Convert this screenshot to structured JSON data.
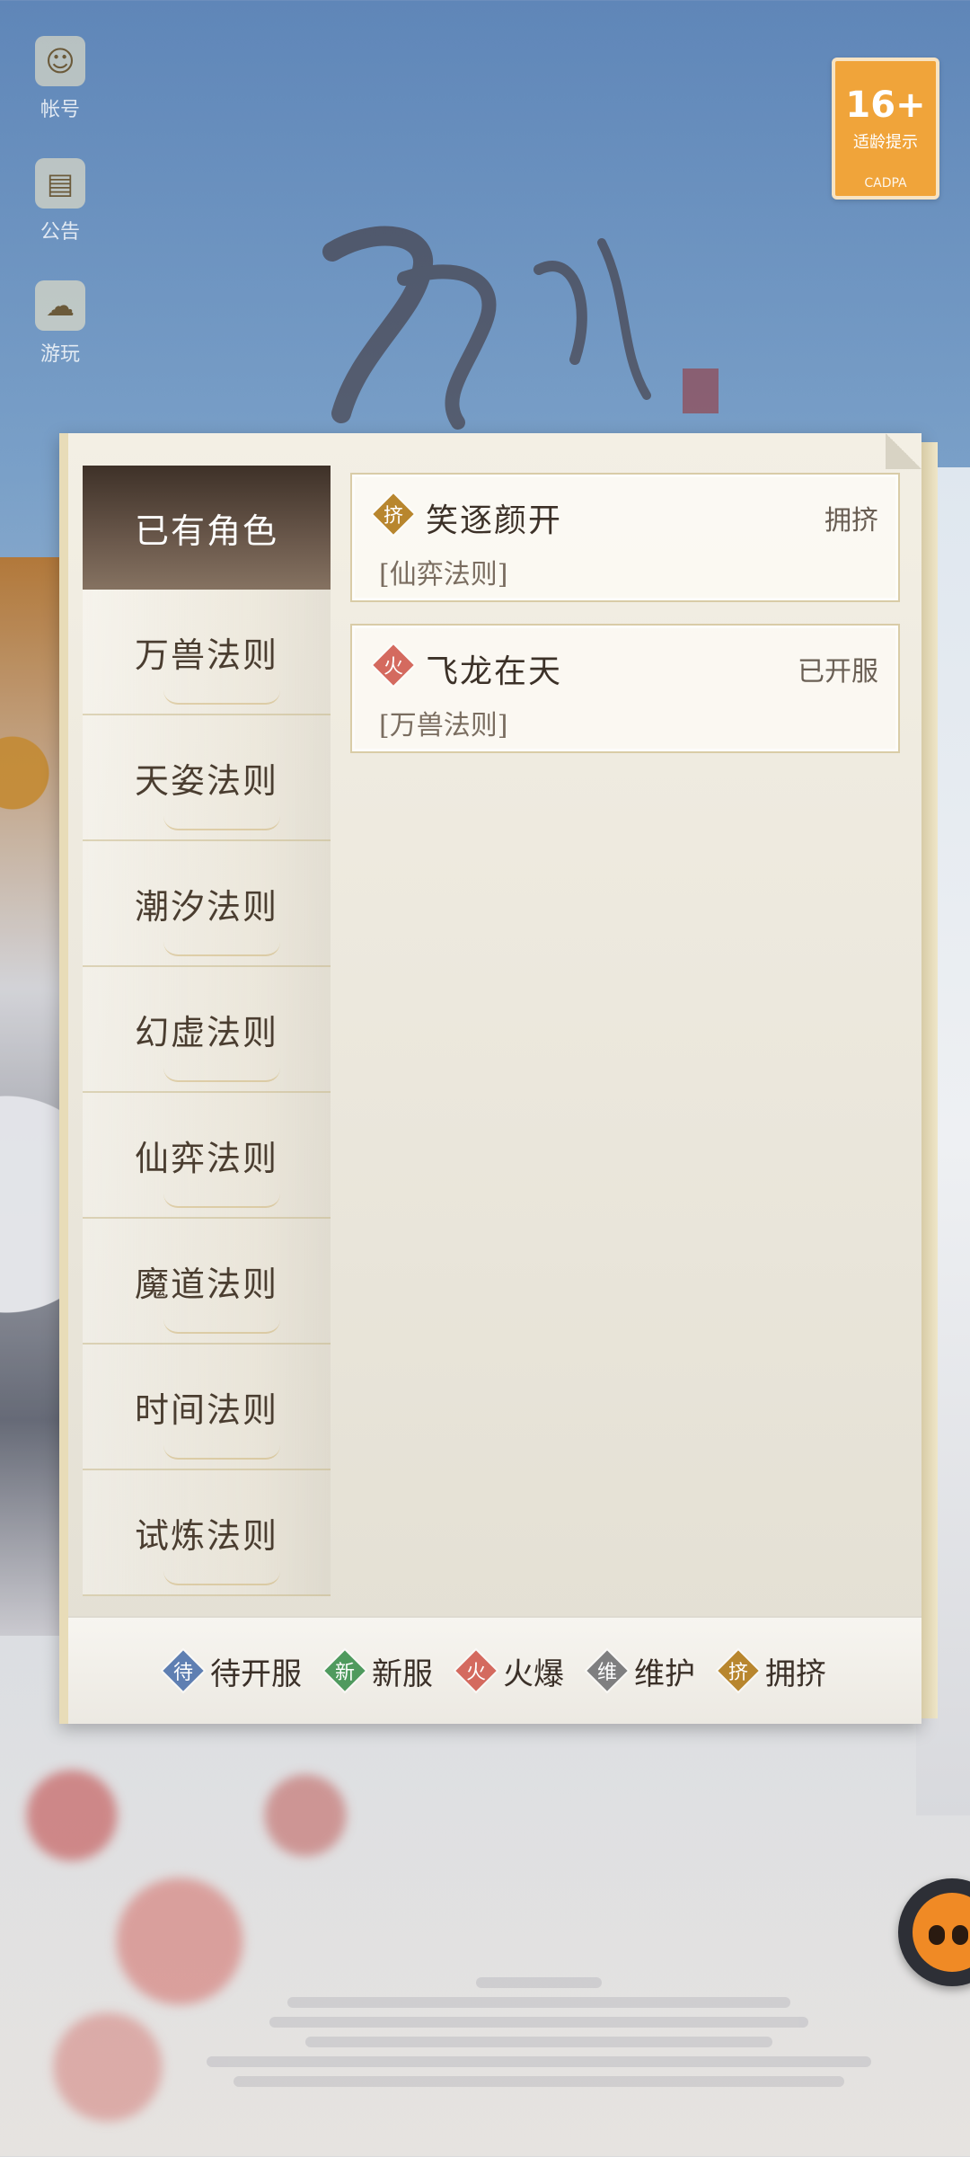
{
  "side_icons": [
    {
      "icon": "account-icon",
      "glyph": "☺",
      "label": "帐号"
    },
    {
      "icon": "notice-icon",
      "glyph": "▤",
      "label": "公告"
    },
    {
      "icon": "cloud-icon",
      "glyph": "☁",
      "label": "游玩"
    }
  ],
  "age_badge": {
    "number": "16+",
    "text": "适龄提示",
    "foot": "CADPA"
  },
  "tabs": [
    {
      "label": "已有角色",
      "active": true
    },
    {
      "label": "万兽法则",
      "active": false
    },
    {
      "label": "天姿法则",
      "active": false
    },
    {
      "label": "潮汐法则",
      "active": false
    },
    {
      "label": "幻虚法则",
      "active": false
    },
    {
      "label": "仙弈法则",
      "active": false
    },
    {
      "label": "魔道法则",
      "active": false
    },
    {
      "label": "时间法则",
      "active": false
    },
    {
      "label": "试炼法则",
      "active": false
    }
  ],
  "servers": [
    {
      "badge": "挤",
      "badge_color": "#b8862e",
      "name": "笑逐颜开",
      "status": "拥挤",
      "realm": "[仙弈法则]"
    },
    {
      "badge": "火",
      "badge_color": "#d46a5f",
      "name": "飞龙在天",
      "status": "已开服",
      "realm": "[万兽法则]"
    }
  ],
  "legend": [
    {
      "badge": "待",
      "color": "#5f7fb2",
      "label": "待开服"
    },
    {
      "badge": "新",
      "color": "#4f9a5e",
      "label": "新服"
    },
    {
      "badge": "火",
      "color": "#d46a5f",
      "label": "火爆"
    },
    {
      "badge": "维",
      "color": "#7f7f80",
      "label": "维护"
    },
    {
      "badge": "挤",
      "color": "#b8862e",
      "label": "拥挤"
    }
  ],
  "panel_deco_text": "",
  "footer_text": ""
}
